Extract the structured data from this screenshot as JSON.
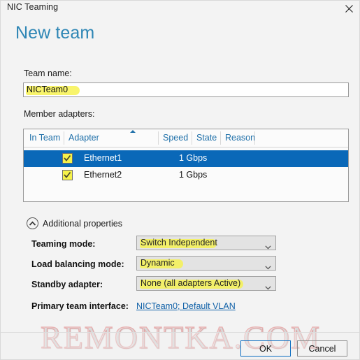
{
  "window": {
    "title": "NIC Teaming",
    "close_icon": "close-icon"
  },
  "heading": "New team",
  "team_name": {
    "label": "Team name:",
    "value": "NICTeam0",
    "highlighted": true
  },
  "member_adapters": {
    "label": "Member adapters:",
    "columns": [
      "In Team",
      "Adapter",
      "Speed",
      "State",
      "Reason"
    ],
    "sort_column": "Adapter",
    "sort_direction": "ascending",
    "rows": [
      {
        "in_team": true,
        "adapter": "Ethernet1",
        "speed": "1 Gbps",
        "state": "",
        "reason": "",
        "selected": true
      },
      {
        "in_team": true,
        "adapter": "Ethernet2",
        "speed": "1 Gbps",
        "state": "",
        "reason": "",
        "selected": false
      }
    ]
  },
  "additional_properties": {
    "label": "Additional properties",
    "toggle_icon": "chevron-up-circle-icon",
    "expanded": true,
    "fields": [
      {
        "label": "Teaming mode:",
        "value": "Switch Independent",
        "type": "dropdown",
        "highlighted": true
      },
      {
        "label": "Load balancing mode:",
        "value": "Dynamic",
        "type": "dropdown",
        "highlighted": true
      },
      {
        "label": "Standby adapter:",
        "value": "None (all adapters Active)",
        "type": "dropdown",
        "highlighted": true
      }
    ],
    "primary_team_interface": {
      "label": "Primary team interface:",
      "link_text": "NICTeam0; Default VLAN"
    }
  },
  "footer": {
    "ok_label": "OK",
    "cancel_label": "Cancel"
  },
  "watermark": "REMONTKA.COM",
  "colors": {
    "accent_blue": "#0a68b8",
    "heading_blue": "#2e86b5",
    "header_text_blue": "#1c6ea8",
    "link_blue": "#1262a8",
    "highlight_yellow": "#f6f24a",
    "window_bg": "#f3f3f3",
    "watermark_pink": "#e08282"
  }
}
